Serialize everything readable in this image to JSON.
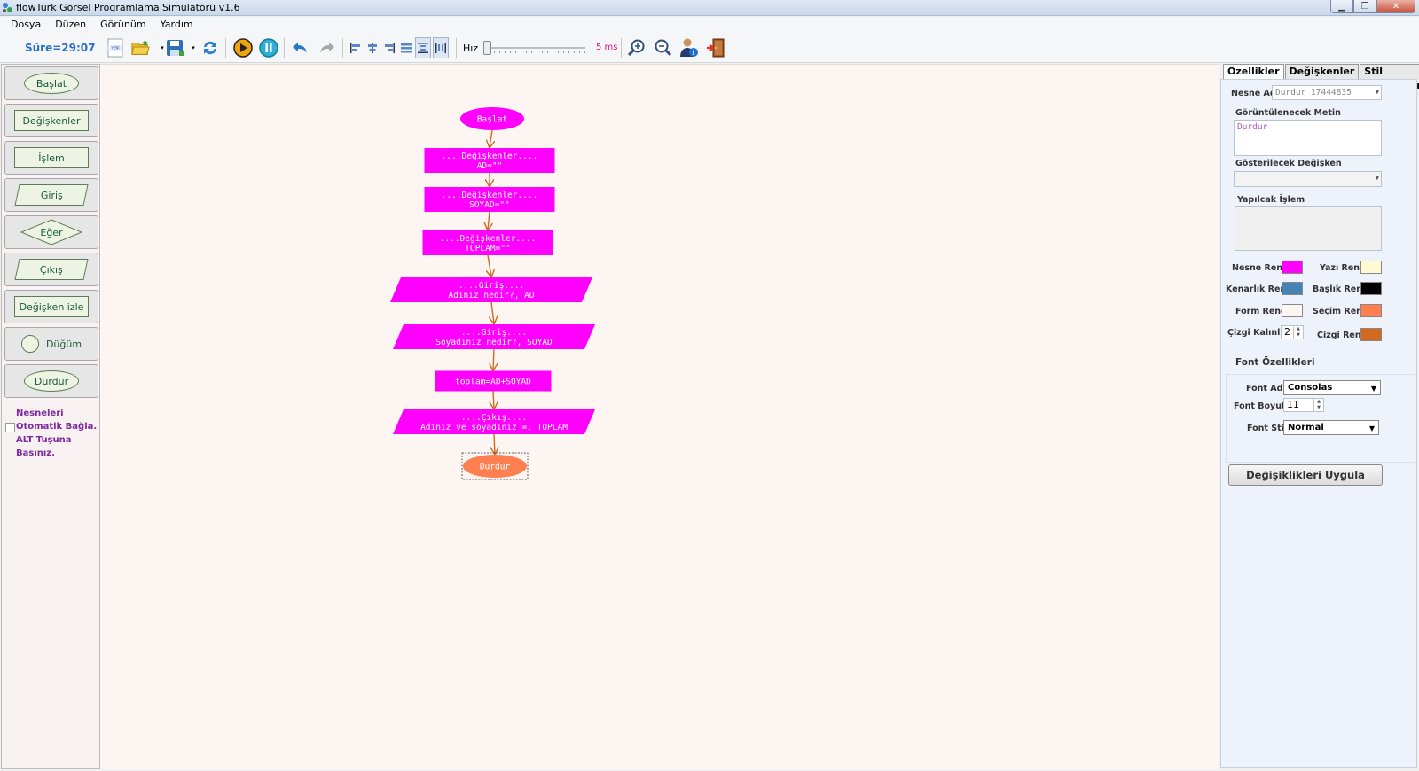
{
  "window": {
    "title": "flowTurk Görsel Programlama Simülatörü v1.6"
  },
  "menu": [
    "Dosya",
    "Düzen",
    "Görünüm",
    "Yardım"
  ],
  "toolbar": {
    "timer": "Süre=29:07",
    "speed_label": "Hız",
    "speed_value": "5 ms",
    "speed_fraction": 0,
    "icons": [
      "new-page-icon",
      "open-folder-icon",
      "save-icon",
      "refresh-icon",
      "play-icon",
      "pause-icon",
      "undo-icon",
      "redo-icon",
      "align-left-icon",
      "align-center-icon",
      "align-right-icon",
      "align-justify-icon",
      "distribute-vertical-icon",
      "distribute-horizontal-icon",
      "zoom-in-icon",
      "zoom-out-icon",
      "user-info-icon",
      "exit-door-icon"
    ]
  },
  "palette": {
    "items": [
      "Başlat",
      "Değişkenler",
      "İşlem",
      "Giriş",
      "Eğer",
      "Çıkış",
      "Değişken izle",
      "Düğüm",
      "Durdur"
    ],
    "auto_connect": "Nesneleri Otomatik Bağla. ALT Tuşuna Basınız."
  },
  "flowchart": {
    "nodes": [
      {
        "type": "oval",
        "lines": [
          "Başlat"
        ]
      },
      {
        "type": "rect",
        "lines": [
          "....Değişkenler....",
          "AD=\"\""
        ]
      },
      {
        "type": "rect",
        "lines": [
          "....Değişkenler....",
          "SOYAD=\"\""
        ]
      },
      {
        "type": "rect",
        "lines": [
          "....Değişkenler....",
          "TOPLAM=\"\""
        ]
      },
      {
        "type": "para",
        "lines": [
          "....Giriş....",
          "Adınız nedir?, AD"
        ]
      },
      {
        "type": "para",
        "lines": [
          "....Giriş....",
          "Soyadınız nedir?, SOYAD"
        ]
      },
      {
        "type": "rect",
        "lines": [
          "toplam=AD+SOYAD"
        ]
      },
      {
        "type": "para",
        "lines": [
          "....Çıkış....",
          "Adınız ve soyadınız =, TOPLAM"
        ]
      },
      {
        "type": "oval",
        "lines": [
          "Durdur"
        ],
        "selected": true
      }
    ],
    "colors": {
      "node": "#ff00ff",
      "stop": "#ff7f50",
      "line": "#d2691e",
      "text": "#ffffff"
    }
  },
  "properties": {
    "tabs": [
      "Özellikler",
      "Değişkenler",
      "Stil Şablonları"
    ],
    "object_name_label": "Nesne Adı",
    "object_name": "Durdur_17444835",
    "display_text_label": "Görüntülenecek Metin",
    "display_text": "Durdur",
    "shown_var_label": "Gösterilecek Değişken",
    "action_label": "Yapılcak İşlem",
    "colors": {
      "object_color_label": "Nesne Rengi:",
      "object_color": "#ff00ff",
      "text_color_label": "Yazı Rengi:",
      "text_color": "#fffbd0",
      "border_color_label": "Kenarlık Rengi:",
      "border_color": "#4682b4",
      "title_color_label": "Başlık Rengi:",
      "title_color": "#000000",
      "form_color_label": "Form Rengi:",
      "form_color": "#fdf5f2",
      "selection_color_label": "Seçim Rengi:",
      "selection_color": "#ff7f50",
      "line_width_label": "Çizgi Kalınlığı:",
      "line_width": "2",
      "line_color_label": "Çizgi Rengi:",
      "line_color": "#d2691e"
    },
    "font": {
      "section_label": "Font Özellikleri",
      "name_label": "Font Adı:",
      "name": "Consolas",
      "size_label": "Font Boyutu:",
      "size": "11",
      "style_label": "Font Stili:",
      "style": "Normal"
    },
    "apply_label": "Değişiklikleri Uygula"
  }
}
